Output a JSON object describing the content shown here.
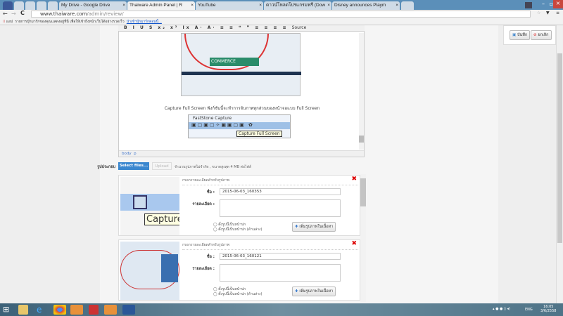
{
  "browser": {
    "tabs": [
      {
        "label": "My Drive - Google Drive"
      },
      {
        "label": "Thaiware Admin Panel | R"
      },
      {
        "label": "YouTube"
      },
      {
        "label": "ดาวน์โหลดโปรแกรมฟรี (Dow"
      },
      {
        "label": "Disney announces Playm"
      }
    ],
    "url_host": "www.thaiware.com",
    "url_path": "/admin/review/",
    "bookmarks": {
      "apps": "แอป",
      "message": "รายการบุ๊กมาร์กของคุณแสดงอยู่ที่นี่ เพื่อให้เข้าถึงหน้าเว็บได้อย่างรวดเร็ว",
      "link": "นำเข้าบุ๊กมาร์กตอนนี้..."
    }
  },
  "editor": {
    "toolbar": "B I U S x₂ x² Ix A· A· ≡ ≡ ❝ ❞ ≡ ≡ ≡ ≡",
    "source": "Source",
    "caption": "Capture Full Screen ฟังก์ชันนี้จะทำการจับภาพทุกส่วนของหน้าจอแบบ Full Screen",
    "fs_title": "FastStone Capture",
    "tooltip": "Capture Full Screen",
    "path": "body  p",
    "commerce": "COMMERCE"
  },
  "actions": {
    "save": "บันทึก",
    "cancel": "ยกเลิก"
  },
  "upload": {
    "label": "รูปประกอบ",
    "select": "Select files...",
    "upload": "Upload",
    "note": "จำนวนรูปภาพไม่จำกัด , ขนาดสูงสุด 4 MB ต่อไฟล์"
  },
  "cards": [
    {
      "header": "กรอกรายละเอียดสำหรับรูปภาพ",
      "name_label": "ชื่อ :",
      "name": "2015-06-03_160353",
      "desc_label": "รายละเอียด :",
      "cover": "ตั้งรูปนี้เป็นหน้าปก",
      "cover2": "ตั้งรูปนี้เป็นหน้าปก (ด้านล่าง)",
      "add": "เพิ่มรูปภาพในเนื้อหา",
      "thumb_text": "Capture"
    },
    {
      "header": "กรอกรายละเอียดสำหรับรูปภาพ",
      "name_label": "ชื่อ :",
      "name": "2015-06-03_160121",
      "desc_label": "รายละเอียด :",
      "cover": "ตั้งรูปนี้เป็นหน้าปก",
      "cover2": "ตั้งรูปนี้เป็นหน้าปก (ด้านล่าง)",
      "add": "เพิ่มรูปภาพในเนื้อหา"
    }
  ],
  "taskbar": {
    "lang": "ENG",
    "time": "16:05",
    "date": "3/6/2558"
  }
}
